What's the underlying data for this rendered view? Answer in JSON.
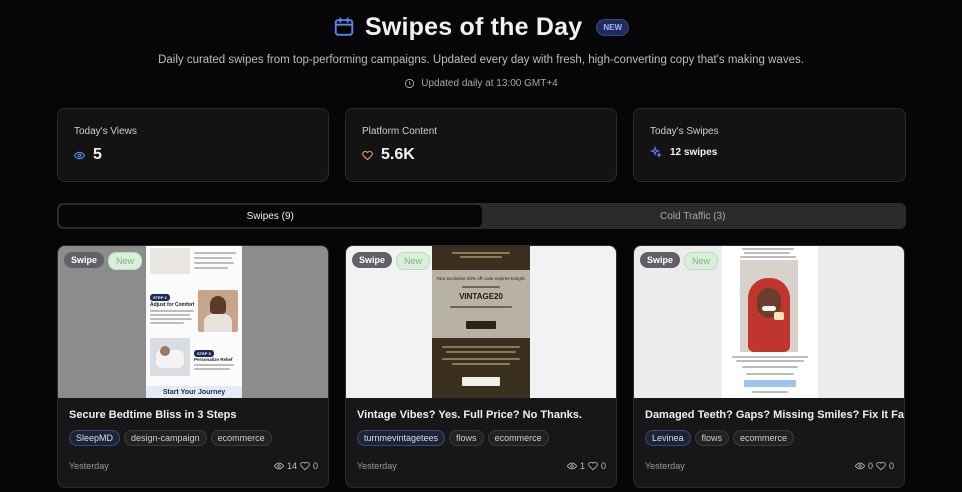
{
  "header": {
    "title": "Swipes of the Day",
    "new_badge": "NEW",
    "subtitle": "Daily curated swipes from top-performing campaigns. Updated every day with fresh, high-converting copy that's making waves.",
    "updated": "Updated daily at 13:00 GMT+4"
  },
  "stats": [
    {
      "label": "Today's Views",
      "value": "5",
      "icon": "eye-icon"
    },
    {
      "label": "Platform Content",
      "value": "5.6K",
      "icon": "heart-icon"
    },
    {
      "label": "Today's Swipes",
      "value": "12 swipes",
      "icon": "sparkles-icon"
    }
  ],
  "tabs": [
    {
      "label": "Swipes (9)",
      "active": true
    },
    {
      "label": "Cold Traffic (3)",
      "active": false
    }
  ],
  "cards": [
    {
      "badge_swipe": "Swipe",
      "badge_new": "New",
      "title": "Secure Bedtime Bliss in 3 Steps",
      "tags": [
        "SleepMD",
        "design-campaign",
        "ecommerce"
      ],
      "date": "Yesterday",
      "views": "14",
      "likes": "0",
      "thumb": {
        "step_label": "STEP 2",
        "step_heading": "Adjust for Comfort",
        "step3_label": "STEP 3",
        "step3_heading": "Personalize Relief",
        "cta": "Start Your Journey"
      }
    },
    {
      "badge_swipe": "Swipe",
      "badge_new": "New",
      "title": "Vintage Vibes? Yes. Full Price? No Thanks.",
      "tags": [
        "turnmevintagetees",
        "flows",
        "ecommerce"
      ],
      "date": "Yesterday",
      "views": "1",
      "likes": "0",
      "thumb": {
        "headline": "Your exclusive 20% off code expires tonight.",
        "code": "VINTAGE20"
      }
    },
    {
      "badge_swipe": "Swipe",
      "badge_new": "New",
      "title": "Damaged Teeth? Gaps? Missing Smiles? Fix It Fast.",
      "tags": [
        "Levinea",
        "flows",
        "ecommerce"
      ],
      "date": "Yesterday",
      "views": "0",
      "likes": "0",
      "thumb": {}
    }
  ],
  "colors": {
    "background": "#060606",
    "card": "#131313",
    "accent_blue": "#5b86f2",
    "accent_orange": "#e09a6a"
  }
}
